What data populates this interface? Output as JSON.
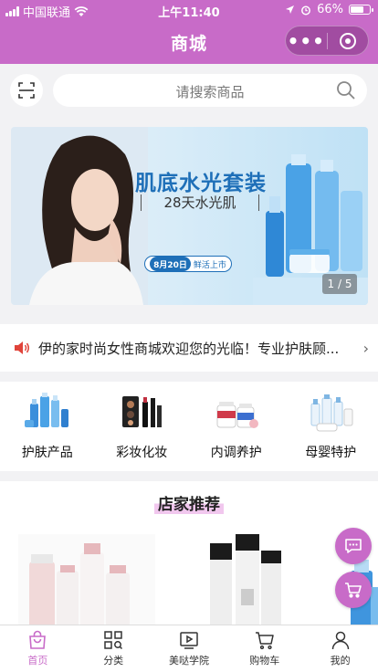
{
  "status_bar": {
    "carrier": "中国联通",
    "time": "上午11:40",
    "battery": "66%"
  },
  "nav": {
    "title": "商城",
    "more_label": "•••"
  },
  "search": {
    "placeholder": "请搜索商品"
  },
  "banner": {
    "headline": "肌底水光套装",
    "subtitle": "28天水光肌",
    "date_tag": "8月20日",
    "date_text": "鲜活上市",
    "counter": "1 / 5"
  },
  "notice": {
    "text": "伊的家时尚女性商城欢迎您的光临！专业护肤顾..."
  },
  "categories": [
    {
      "label": "护肤产品"
    },
    {
      "label": "彩妆化妆"
    },
    {
      "label": "内调养护"
    },
    {
      "label": "母婴特护"
    }
  ],
  "recommend": {
    "title": "店家推荐"
  },
  "tabs": [
    {
      "label": "首页",
      "icon": "bag-icon",
      "active": true
    },
    {
      "label": "分类",
      "icon": "grid-icon"
    },
    {
      "label": "美哒学院",
      "icon": "video-icon"
    },
    {
      "label": "购物车",
      "icon": "cart-icon"
    },
    {
      "label": "我的",
      "icon": "user-icon"
    }
  ],
  "colors": {
    "brand": "#c86bc8",
    "accent_blue": "#1e6fb8"
  }
}
